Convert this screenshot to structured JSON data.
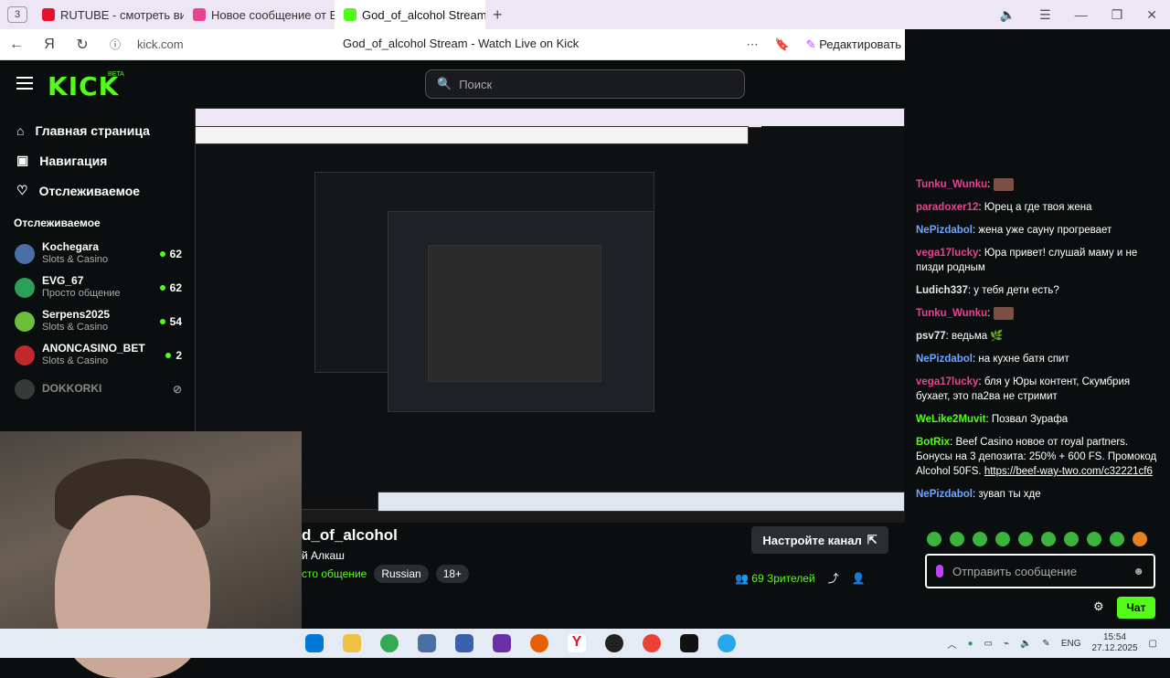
{
  "browser": {
    "tab_count": "3",
    "tabs": [
      {
        "label": "RUTUBE - смотреть виде",
        "color": "#e8112d"
      },
      {
        "label": "Новое сообщение от Eliza",
        "color": "#e84393"
      },
      {
        "label": "God_of_alcohol Stream",
        "color": "#53fc18"
      }
    ],
    "url": "kick.com",
    "page_title": "God_of_alcohol Stream - Watch Live on Kick",
    "edit_label": "Редактировать"
  },
  "header": {
    "logo": "KICK",
    "beta": "BETA",
    "search_placeholder": "Поиск"
  },
  "sidebar": {
    "nav": [
      {
        "label": "Главная страница",
        "icon": "home-icon"
      },
      {
        "label": "Навигация",
        "icon": "browse-icon"
      },
      {
        "label": "Отслеживаемое",
        "icon": "heart-icon"
      }
    ],
    "section_title": "Отслеживаемое",
    "channels": [
      {
        "name": "Kochegara",
        "category": "Slots & Casino",
        "viewers": "62",
        "color": "#4a6fa5"
      },
      {
        "name": "EVG_67",
        "category": "Просто общение",
        "viewers": "62",
        "color": "#2aa05a"
      },
      {
        "name": "Serpens2025",
        "category": "Slots & Casino",
        "viewers": "54",
        "color": "#6bbf3a"
      },
      {
        "name": "ANONCASINO_BET",
        "category": "Slots & Casino",
        "viewers": "2",
        "color": "#c0282d"
      },
      {
        "name": "DOKKORKI",
        "category": "",
        "viewers": "",
        "color": "#666666"
      }
    ]
  },
  "channel": {
    "title": "d_of_alcohol",
    "subtitle": "й Алкаш",
    "category": "сто общение",
    "tags": [
      "Russian",
      "18+"
    ],
    "setup_label": "Настройте канал",
    "viewers": "69 Зрителей"
  },
  "chat": {
    "messages": [
      {
        "user": "Tunku_Wunku",
        "color": "#e84393",
        "text": "",
        "emote": true
      },
      {
        "user": "paradoxer12",
        "color": "#e84393",
        "text": "Юрец а где твоя жена"
      },
      {
        "user": "NePizdabol",
        "color": "#6ea6ff",
        "text": "жена уже сауну прогревает"
      },
      {
        "user": "vega17lucky",
        "color": "#e84393",
        "text": "Юра привет! слушай маму и не пизди родным"
      },
      {
        "user": "Ludich337",
        "color": "#e8e8e8",
        "text": "у тебя дети есть?"
      },
      {
        "user": "Tunku_Wunku",
        "color": "#e84393",
        "text": "",
        "emote": true
      },
      {
        "user": "psv77",
        "color": "#e8e8e8",
        "text": "ведьма 🌿"
      },
      {
        "user": "NePizdabol",
        "color": "#6ea6ff",
        "text": "на кухне батя спит"
      },
      {
        "user": "vega17lucky",
        "color": "#e84393",
        "text": "бля у Юры контент, Скумбрия бухает, это па2ва не стримит"
      },
      {
        "user": "WeLike2Muvit",
        "color": "#53fc18",
        "text": "Позвал Зурафа"
      },
      {
        "user": "BotRix",
        "color": "#53fc18",
        "text": "Beef Casino новое от royal partners. Бонусы на 3 депозита: 250% + 600 FS. Промокод Alcohol 50FS.",
        "link": "https://beef-way-two.com/c32221cf6"
      },
      {
        "user": "NePizdabol",
        "color": "#6ea6ff",
        "text": "зувап ты хде"
      }
    ],
    "input_placeholder": "Отправить сообщение",
    "send_label": "Чат"
  },
  "taskbar": {
    "lang": "ENG",
    "time": "15:54",
    "date": "27.12.2025"
  }
}
